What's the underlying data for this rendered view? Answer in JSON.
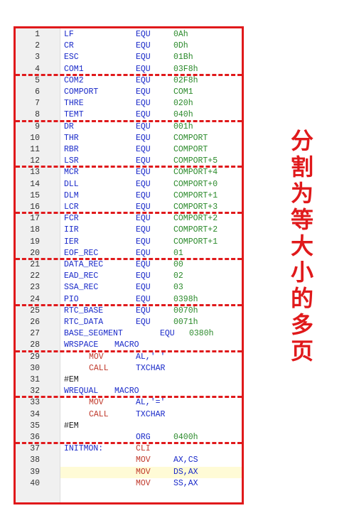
{
  "editor": {
    "lines": [
      {
        "n": "1",
        "a": "LF",
        "b": "EQU",
        "c": "0Ah",
        "indent": false
      },
      {
        "n": "2",
        "a": "CR",
        "b": "EQU",
        "c": "0Dh",
        "indent": false
      },
      {
        "n": "3",
        "a": "ESC",
        "b": "EQU",
        "c": "01Bh",
        "indent": false
      },
      {
        "n": "4",
        "a": "COM1",
        "b": "EQU",
        "c": "03F8h",
        "indent": false
      },
      {
        "n": "5",
        "a": "COM2",
        "b": "EQU",
        "c": "02F8h",
        "indent": false
      },
      {
        "n": "6",
        "a": "COMPORT",
        "b": "EQU",
        "c": "COM1",
        "indent": false
      },
      {
        "n": "7",
        "a": "THRE",
        "b": "EQU",
        "c": "020h",
        "indent": false
      },
      {
        "n": "8",
        "a": "TEMT",
        "b": "EQU",
        "c": "040h",
        "indent": false
      },
      {
        "n": "9",
        "a": "DR",
        "b": "EQU",
        "c": "001h",
        "indent": false
      },
      {
        "n": "10",
        "a": "THR",
        "b": "EQU",
        "c": "COMPORT",
        "indent": false
      },
      {
        "n": "11",
        "a": "RBR",
        "b": "EQU",
        "c": "COMPORT",
        "indent": false
      },
      {
        "n": "12",
        "a": "LSR",
        "b": "EQU",
        "c": "COMPORT+5",
        "indent": false
      },
      {
        "n": "13",
        "a": "MCR",
        "b": "EQU",
        "c": "COMPORT+4",
        "indent": false
      },
      {
        "n": "14",
        "a": "DLL",
        "b": "EQU",
        "c": "COMPORT+0",
        "indent": false
      },
      {
        "n": "15",
        "a": "DLM",
        "b": "EQU",
        "c": "COMPORT+1",
        "indent": false
      },
      {
        "n": "16",
        "a": "LCR",
        "b": "EQU",
        "c": "COMPORT+3",
        "indent": false
      },
      {
        "n": "17",
        "a": "FCR",
        "b": "EQU",
        "c": "COMPORT+2",
        "indent": false
      },
      {
        "n": "18",
        "a": "IIR",
        "b": "EQU",
        "c": "COMPORT+2",
        "indent": false
      },
      {
        "n": "19",
        "a": "IER",
        "b": "EQU",
        "c": "COMPORT+1",
        "indent": false
      },
      {
        "n": "20",
        "a": "EOF_REC",
        "b": "EQU",
        "c": "01",
        "indent": false
      },
      {
        "n": "21",
        "a": "DATA_REC",
        "b": "EQU",
        "c": "00",
        "indent": false
      },
      {
        "n": "22",
        "a": "EAD_REC",
        "b": "EQU",
        "c": "02",
        "indent": false
      },
      {
        "n": "23",
        "a": "SSA_REC",
        "b": "EQU",
        "c": "03",
        "indent": false
      },
      {
        "n": "24",
        "a": "PIO",
        "b": "EQU",
        "c": "0398h",
        "indent": false
      },
      {
        "n": "25",
        "a": "RTC_BASE",
        "b": "EQU",
        "c": "0070h",
        "indent": false
      },
      {
        "n": "26",
        "a": "RTC_DATA",
        "b": "EQU",
        "c": "0071h",
        "indent": false
      },
      {
        "n": "27",
        "a": "BASE_SEGMENT",
        "b": "EQU",
        "c": "0380h",
        "indent": false,
        "wide": true
      },
      {
        "n": "28",
        "a": "WRSPACE",
        "b": "MACRO",
        "c": "",
        "indent": false,
        "macro": true
      },
      {
        "n": "29",
        "a": "",
        "b": "MOV",
        "c": "AL,' '",
        "indent": true
      },
      {
        "n": "30",
        "a": "",
        "b": "CALL",
        "c": "TXCHAR",
        "indent": true
      },
      {
        "n": "31",
        "a": "#EM",
        "b": "",
        "c": "",
        "indent": false,
        "plain": true
      },
      {
        "n": "32",
        "a": "WREQUAL",
        "b": "MACRO",
        "c": "",
        "indent": false,
        "macro": true
      },
      {
        "n": "33",
        "a": "",
        "b": "MOV",
        "c": "AL,'='",
        "indent": true
      },
      {
        "n": "34",
        "a": "",
        "b": "CALL",
        "c": "TXCHAR",
        "indent": true
      },
      {
        "n": "35",
        "a": "#EM",
        "b": "",
        "c": "",
        "indent": false,
        "plain": true
      },
      {
        "n": "36",
        "a": "",
        "b": "ORG",
        "c": "0400h",
        "indent": false
      },
      {
        "n": "37",
        "a": "INITMON:",
        "b": "CLI",
        "c": "",
        "indent": false,
        "ins": true
      },
      {
        "n": "38",
        "a": "",
        "b": "MOV",
        "c": "AX,CS",
        "indent": false,
        "ins": true
      },
      {
        "n": "39",
        "a": "",
        "b": "MOV",
        "c": "DS,AX",
        "indent": false,
        "ins": true,
        "highlight": true
      },
      {
        "n": "40",
        "a": "",
        "b": "MOV",
        "c": "SS,AX",
        "indent": false,
        "ins": true
      }
    ],
    "separators_after_lines": [
      4,
      8,
      12,
      16,
      20,
      24,
      28,
      32,
      36
    ]
  },
  "caption": {
    "chars": [
      "分",
      "割",
      "为",
      "等",
      "大",
      "小",
      "的",
      "多",
      "页"
    ]
  },
  "colors": {
    "frame": "#e0191b",
    "label": "#1a2ac9",
    "value": "#2b8a2b",
    "instruction": "#c0392b",
    "highlight": "#fffbd6"
  }
}
